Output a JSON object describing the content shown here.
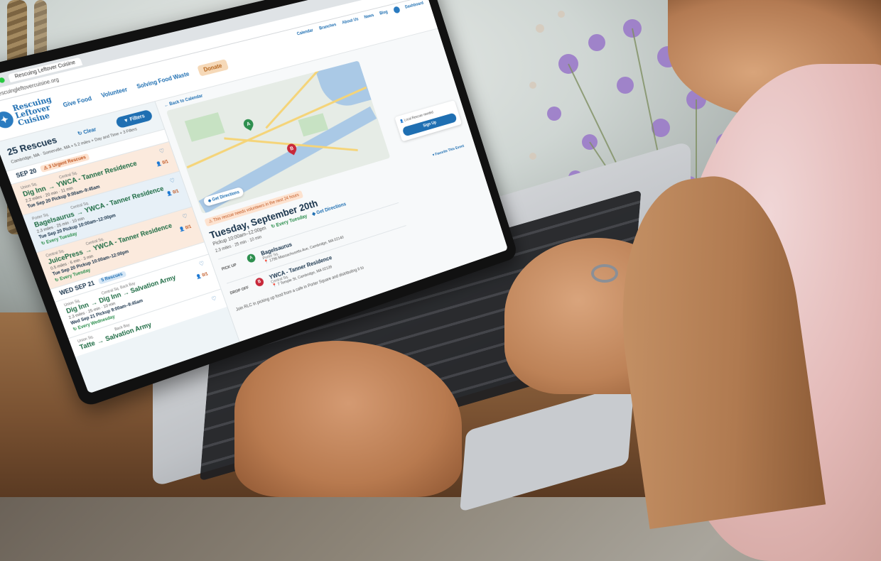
{
  "browser": {
    "tab_title": "Rescuing Leftover Cuisine",
    "url": "rescuingleftovercuisine.org"
  },
  "header": {
    "logo_lines": [
      "Rescuing",
      "Leftover",
      "Cuisine"
    ],
    "nav": [
      "Give Food",
      "Volunteer",
      "Solving Food Waste"
    ],
    "donate": "Donate",
    "top_nav": [
      "Calendar",
      "Branches",
      "About Us",
      "News",
      "Blog",
      "Dashboard"
    ]
  },
  "sidebar": {
    "count": "25 Rescues",
    "clear": "Clear",
    "filters": "Filters",
    "filter_summary": "Cambridge, MA · Somerville, MA + 5.2 miles + Day and Time + 3 Filters",
    "days": [
      {
        "label": "SEP 20",
        "badge": "3 Urgent Rescues",
        "badge_type": "urgent",
        "rescues": [
          {
            "from_area": "Union Sq.",
            "to_area": "Central Sq.",
            "from": "Dig Inn",
            "to": "YWCA - Tanner Residence",
            "meta": "2.2 miles · 20 min · 11 min",
            "time": "Tue Sep 20  Pickup 9:00am–9:45am",
            "every": "",
            "slots": "0/1",
            "style": "urgent"
          },
          {
            "from_area": "Porter Sq.",
            "to_area": "Central Sq.",
            "from": "Bagelsaurus",
            "to": "YWCA - Tanner Residence",
            "meta": "2.3 miles · 25 min · 10 min",
            "time": "Tue Sep 20  Pickup 10:00am–12:00pm",
            "every": "Every Tuesday",
            "slots": "0/1",
            "style": "blue"
          },
          {
            "from_area": "Central Sq.",
            "to_area": "Central Sq.",
            "from": "JuicePress",
            "to": "YWCA - Tanner Residence",
            "meta": "0.5 miles · 6 min · 3 min",
            "time": "Tue Sep 20  Pickup 10:00am–12:00pm",
            "every": "Every Tuesday",
            "slots": "0/1",
            "style": "urgent"
          }
        ]
      },
      {
        "label": "WED SEP 21",
        "badge": "5 Rescues",
        "badge_type": "count",
        "rescues": [
          {
            "from_area": "Union Sq.",
            "to_area": "Central Sq.  Back Bay",
            "from": "Dig Inn",
            "to": "Dig Inn → Salvation Army",
            "meta": "2.3 miles · 25 min · 10 min",
            "time": "Wed Sep 21  Pickup 9:00am–9:45am",
            "every": "Every Wednesday",
            "slots": "0/1",
            "style": "normal"
          },
          {
            "from_area": "Union Sq.",
            "to_area": "Back Bay",
            "from": "Tatte",
            "to": "Salvation Army",
            "meta": "",
            "time": "",
            "every": "",
            "slots": "",
            "style": "normal"
          }
        ]
      }
    ]
  },
  "detail": {
    "back": "Back to Calendar",
    "get_directions_map": "Get Directions",
    "signup_note": "Local Rescuer needed",
    "signup_button": "Sign Up",
    "favorite": "Favorite This Event",
    "warning": "This rescue needs volunteers in the next 24 hours",
    "date_title": "Tuesday, September 20th",
    "pickup": "Pickup 10:00am–12:00pm",
    "every": "Every Tuesday",
    "get_directions": "Get Directions",
    "distance": "2.3 miles · 25 min · 10 min",
    "pickup_stop": {
      "label": "PICK UP",
      "pin": "A",
      "name": "Bagelsaurus",
      "sub": "Porter Sq.",
      "addr": "1796 Massachusetts Ave, Cambridge, MA 02140"
    },
    "dropoff_stop": {
      "label": "DROP OFF",
      "pin": "B",
      "name": "YWCA - Tanner Residence",
      "sub": "Central Sq.",
      "addr": "7 Temple St, Cambridge, MA 02139"
    },
    "description": "Join RLC in picking up food from a cafe in Porter Square and distributing it to"
  },
  "colors": {
    "brand_blue": "#1f6fb2",
    "green": "#2d8f4e",
    "urgent_orange": "#c0551f",
    "pin_red": "#c8283a"
  }
}
